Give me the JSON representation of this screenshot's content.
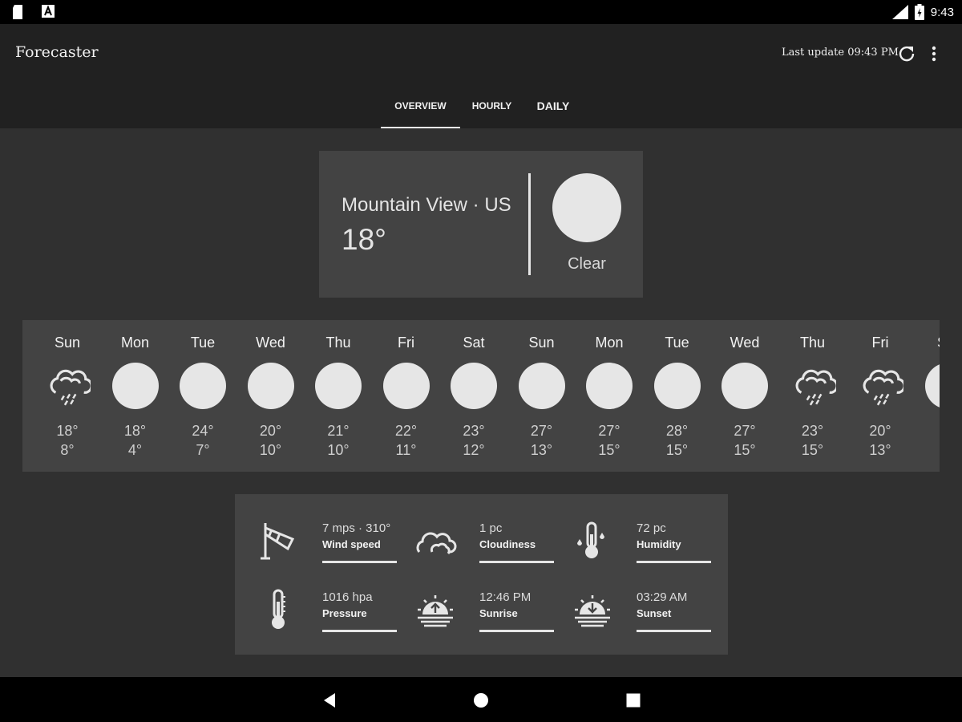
{
  "status_bar": {
    "time": "9:43",
    "icons": [
      "sd-card-icon",
      "notification-a-icon",
      "signal-icon",
      "battery-icon"
    ]
  },
  "app": {
    "title": "Forecaster",
    "last_update": "Last update 09:43 PM"
  },
  "tabs": [
    {
      "label": "OVERVIEW",
      "selected": true
    },
    {
      "label": "HOURLY",
      "selected": false
    },
    {
      "label": "DAILY",
      "selected": false
    }
  ],
  "current": {
    "location": "Mountain View · US",
    "temperature": "18°",
    "condition": "Clear",
    "icon": "sun-icon"
  },
  "forecast": [
    {
      "day": "Sun",
      "high": "18°",
      "low": "8°",
      "icon": "rain-cloud-icon"
    },
    {
      "day": "Mon",
      "high": "18°",
      "low": "4°",
      "icon": "sun-icon"
    },
    {
      "day": "Tue",
      "high": "24°",
      "low": "7°",
      "icon": "sun-icon"
    },
    {
      "day": "Wed",
      "high": "20°",
      "low": "10°",
      "icon": "sun-icon"
    },
    {
      "day": "Thu",
      "high": "21°",
      "low": "10°",
      "icon": "sun-icon"
    },
    {
      "day": "Fri",
      "high": "22°",
      "low": "11°",
      "icon": "sun-icon"
    },
    {
      "day": "Sat",
      "high": "23°",
      "low": "12°",
      "icon": "sun-icon"
    },
    {
      "day": "Sun",
      "high": "27°",
      "low": "13°",
      "icon": "sun-icon"
    },
    {
      "day": "Mon",
      "high": "27°",
      "low": "15°",
      "icon": "sun-icon"
    },
    {
      "day": "Tue",
      "high": "28°",
      "low": "15°",
      "icon": "sun-icon"
    },
    {
      "day": "Wed",
      "high": "27°",
      "low": "15°",
      "icon": "sun-icon"
    },
    {
      "day": "Thu",
      "high": "23°",
      "low": "15°",
      "icon": "rain-cloud-icon"
    },
    {
      "day": "Fri",
      "high": "20°",
      "low": "13°",
      "icon": "rain-cloud-icon"
    },
    {
      "day": "Sat",
      "high": "",
      "low": "",
      "icon": "sun-icon"
    }
  ],
  "details": [
    {
      "value": "7 mps · 310°",
      "label": "Wind speed",
      "icon": "windsock-icon"
    },
    {
      "value": "1 pc",
      "label": "Cloudiness",
      "icon": "cloud-icon"
    },
    {
      "value": "72 pc",
      "label": "Humidity",
      "icon": "humidity-thermometer-icon"
    },
    {
      "value": "1016 hpa",
      "label": "Pressure",
      "icon": "thermometer-icon"
    },
    {
      "value": "12:46 PM",
      "label": "Sunrise",
      "icon": "sunrise-icon"
    },
    {
      "value": "03:29 AM",
      "label": "Sunset",
      "icon": "sunset-icon"
    }
  ],
  "nav": [
    "back-icon",
    "home-icon",
    "recents-icon"
  ]
}
